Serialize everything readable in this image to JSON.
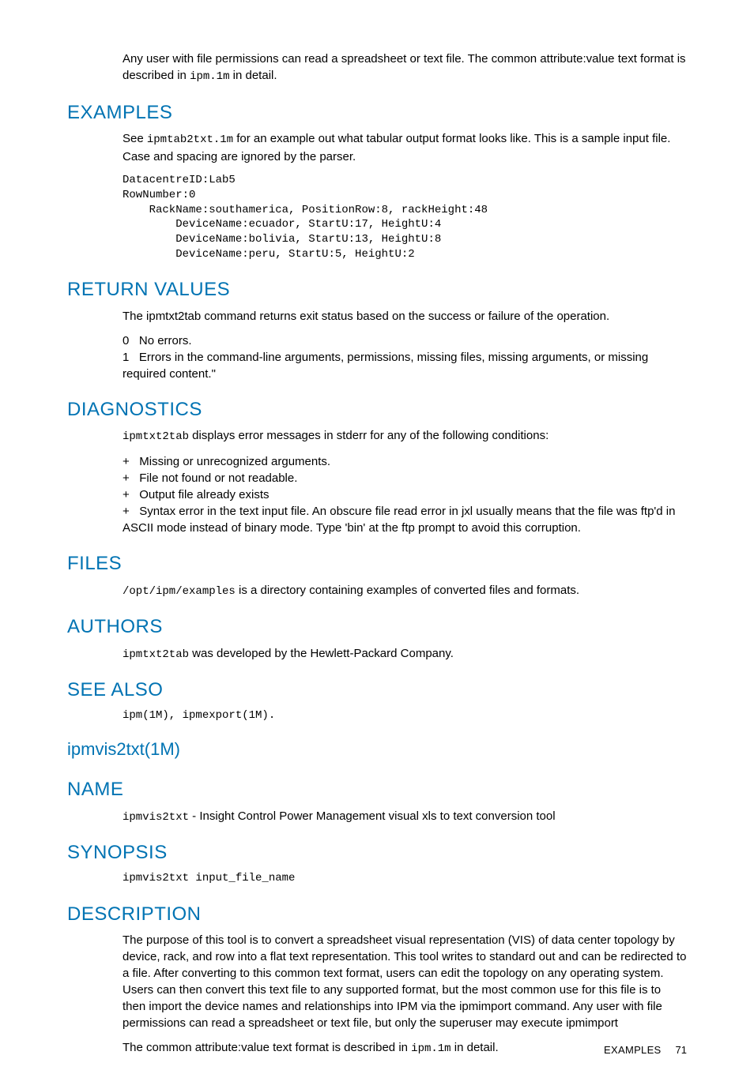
{
  "intro": {
    "p1a": "Any user with file permissions can read a spreadsheet or text file. The common attribute:value text format is described in ",
    "p1_code": "ipm.1m",
    "p1b": " in detail."
  },
  "examples": {
    "heading": "Examples",
    "p1a": "See ",
    "p1_code": "ipmtab2txt.1m",
    "p1b": " for an example out what tabular output format looks like. This is a sample input file. Case and spacing are ignored by the parser.",
    "code": "DatacentreID:Lab5\nRowNumber:0\n    RackName:southamerica, PositionRow:8, rackHeight:48\n        DeviceName:ecuador, StartU:17, HeightU:4\n        DeviceName:bolivia, StartU:13, HeightU:8\n        DeviceName:peru, StartU:5, HeightU:2"
  },
  "return_values": {
    "heading": "Return Values",
    "p1": "The ipmtxt2tab command returns exit status based on the success or failure of the operation.",
    "code0": "0",
    "line0": "No errors.",
    "code1": "1",
    "line1": "Errors in the command-line arguments, permissions, missing files, missing arguments, or missing required content.\""
  },
  "diagnostics": {
    "heading": "Diagnostics",
    "p1_code": "ipmtxt2tab",
    "p1b": " displays error messages in stderr for any of the following conditions:",
    "b1": "Missing or unrecognized arguments.",
    "b2": "File not found or not readable.",
    "b3": "Output file already exists",
    "b4": "Syntax error in the text input file. An obscure file read error in jxl usually means that the file was ftp'd in ASCII mode instead of binary mode. Type 'bin' at the ftp prompt to avoid this corruption."
  },
  "files": {
    "heading": "Files",
    "p1_code": "/opt/ipm/examples",
    "p1b": " is a directory containing examples of converted files and formats."
  },
  "authors": {
    "heading": "Authors",
    "p1_code": "ipmtxt2tab",
    "p1b": " was developed by the Hewlett-Packard Company."
  },
  "see_also": {
    "heading": "See Also",
    "code": "ipm(1M), ipmexport(1M)."
  },
  "ipmvis": {
    "heading": "ipmvis2txt(1M)"
  },
  "name": {
    "heading": "Name",
    "p1_code": "ipmvis2txt",
    "p1b": " - Insight Control Power Management visual xls to text conversion tool"
  },
  "synopsis": {
    "heading": "Synopsis",
    "code": "ipmvis2txt input_file_name"
  },
  "description": {
    "heading": "Description",
    "p1": "The purpose of this tool is to convert a spreadsheet visual representation (VIS) of data center topology by device, rack, and row into a flat text representation. This tool writes to standard out and can be redirected to a file. After converting to this common text format, users can edit the topology on any operating system. Users can then convert this text file to any supported format, but the most common use for this file is to then import the device names and relationships into IPM via the ipmimport command. Any user with file permissions can read a spreadsheet or text file, but only the superuser may execute ipmimport",
    "p2a": "The common attribute:value text format is described in ",
    "p2_code": "ipm.1m",
    "p2b": " in detail."
  },
  "footer": {
    "label": "EXAMPLES",
    "page": "71"
  }
}
